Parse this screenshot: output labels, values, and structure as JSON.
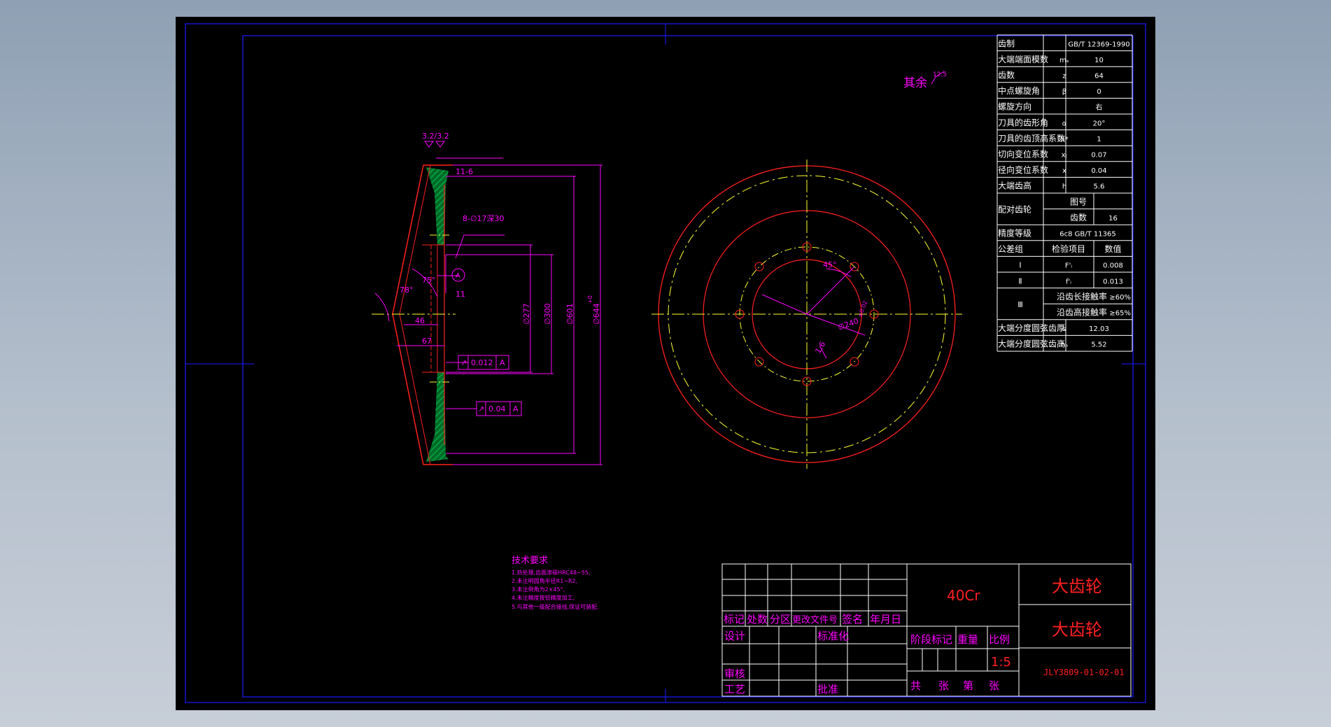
{
  "colors": {
    "background": "#000000",
    "frame": "#1a1aff",
    "dimension": "#ff00ff",
    "outline": "#ff2020",
    "centerline": "#ffff33",
    "table_text": "#ffffff",
    "section_hatch": "#009b3a"
  },
  "surface_note": {
    "label": "其余",
    "roughness": "12.5"
  },
  "section_view": {
    "roughness_top": "3.2/3.2",
    "dim_top": "11-6",
    "holes": "8-∅17深30",
    "angle_back": "75°",
    "angle_face": "78°",
    "dim_46": "46",
    "dim_67": "67",
    "dim_11": "11",
    "dim_d277": "∅277",
    "dim_d300": "∅300",
    "dim_d601": "∅601",
    "dim_d644": "∅644",
    "tol_644": "+0",
    "datum": "A",
    "fcf_runout": [
      "↗",
      "0.012",
      "A"
    ],
    "fcf_runout2": [
      "↗",
      "0.04",
      "A"
    ]
  },
  "front_view": {
    "angle": "45°",
    "pcd": "∅240",
    "pcd_tol": "±0.02",
    "small_dim": "1.6"
  },
  "gear_params": [
    [
      "齿制",
      "",
      "GB/T 12369-1990"
    ],
    [
      "大端端面模数",
      "mₑ",
      "10"
    ],
    [
      "齿数",
      "z",
      "64"
    ],
    [
      "中点螺旋角",
      "β",
      "0"
    ],
    [
      "螺旋方向",
      "",
      "右"
    ],
    [
      "刀具的齿形角",
      "α",
      "20°"
    ],
    [
      "刀具的齿顶高系数",
      "h*",
      "1"
    ],
    [
      "切向变位系数",
      "xₜ",
      "0.07"
    ],
    [
      "径向变位系数",
      "x",
      "0.04"
    ],
    [
      "大端齿高",
      "h",
      "5.6"
    ],
    [
      "精度等级",
      "",
      "6c8 GB/T 11365"
    ],
    [
      "大端分度圆弦齿厚",
      "s",
      "12.03"
    ],
    [
      "大端分度圆弦齿高",
      "hₐ",
      "5.52"
    ]
  ],
  "mating_gear": {
    "label": "配对齿轮",
    "drawing_no_label": "图号",
    "drawing_no": "",
    "teeth_label": "齿数",
    "teeth": "16"
  },
  "tolerance_group": {
    "label": "公差组",
    "item_header": "检验项目",
    "value_header": "数值",
    "rows": [
      {
        "group": "Ⅰ",
        "symbol": "F'ᵢ",
        "value": "0.008"
      },
      {
        "group": "Ⅱ",
        "symbol": "f'ᵢ",
        "value": "0.013"
      }
    ],
    "group3": "Ⅲ",
    "contact_long": "沿齿长接触率",
    "contact_long_value": "≥60%",
    "contact_high": "沿齿高接触率",
    "contact_high_value": "≥65%"
  },
  "tech_requirements": {
    "title": "技术要求",
    "items": [
      "1.热处理,齿面渗碳HRC48~55,",
      "2.未注明圆角半径R1~R2,",
      "3.未注倒角为2×45°,",
      "4.未注精度按低精度加工,",
      "5.与其他一级配合接线,保证可装配."
    ]
  },
  "title_block": {
    "material": "40Cr",
    "name_1": "大齿轮",
    "name_2": "大齿轮",
    "header_row": [
      "标记",
      "处数",
      "分区",
      "更改文件号",
      "签名",
      "年月日"
    ],
    "design": "设计",
    "standardize": "标准化",
    "check": "审核",
    "process": "工艺",
    "approve": "批准",
    "stage_mark": "阶段标记",
    "weight": "重量",
    "scale_label": "比例",
    "scale": "1:5",
    "sheets": [
      "共",
      "张",
      "第",
      "张"
    ],
    "drawing_number": "JLY3809-01-02-01"
  }
}
